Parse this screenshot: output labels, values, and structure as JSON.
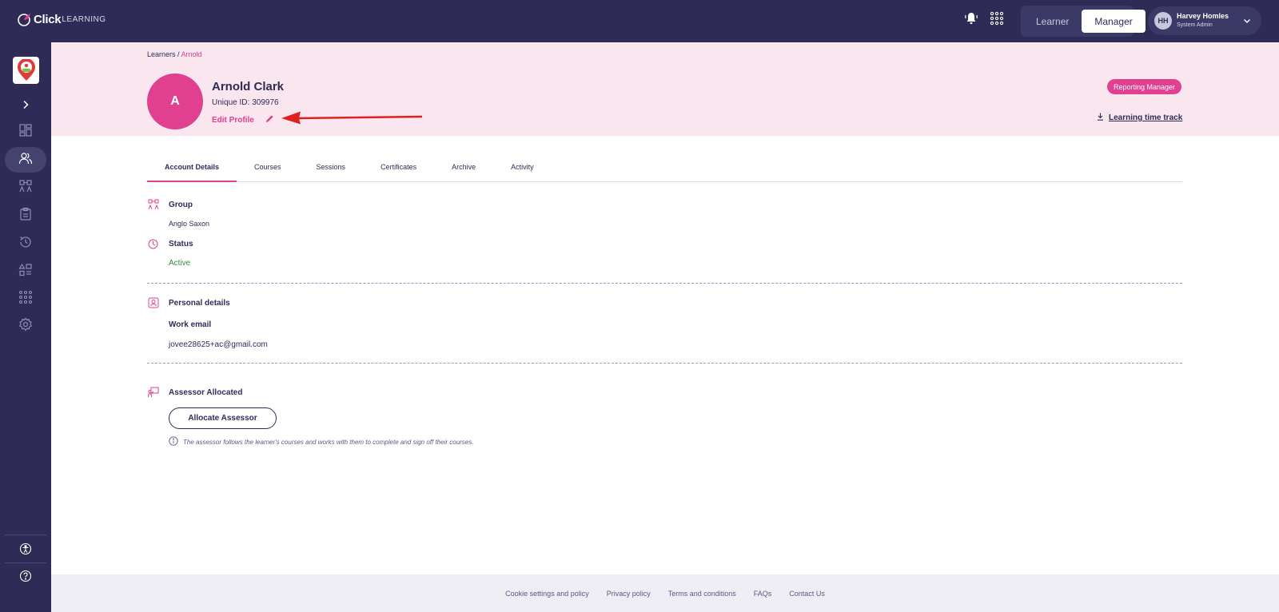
{
  "brand": {
    "click": "Click",
    "learning": "LEARNING"
  },
  "topbar": {
    "roles": [
      {
        "label": "Learner",
        "active": false
      },
      {
        "label": "Manager",
        "active": true
      }
    ],
    "user": {
      "initials": "HH",
      "name": "Harvey Homles",
      "role": "System Admin"
    }
  },
  "sidebar": {
    "items": [
      {
        "name": "expand-chevron-icon"
      },
      {
        "name": "dashboard-icon"
      },
      {
        "name": "learners-icon",
        "active": true
      },
      {
        "name": "groups-icon"
      },
      {
        "name": "clipboard-icon"
      },
      {
        "name": "history-icon"
      },
      {
        "name": "reports-icon"
      },
      {
        "name": "apps-grid-icon"
      },
      {
        "name": "settings-icon"
      }
    ],
    "bottom": [
      {
        "name": "accessibility-icon"
      },
      {
        "name": "help-icon"
      }
    ]
  },
  "breadcrumb": {
    "parent": "Learners",
    "separator": " / ",
    "current": "Arnold"
  },
  "profile": {
    "initial": "A",
    "name": "Arnold Clark",
    "unique_id_label": "Unique ID:",
    "unique_id": "309976",
    "edit_label": "Edit Profile",
    "badge": "Reporting Manager",
    "time_track": "Learning time track"
  },
  "tabs": [
    "Account Details",
    "Courses",
    "Sessions",
    "Certificates",
    "Archive",
    "Activity"
  ],
  "active_tab": "Account Details",
  "account": {
    "group_label": "Group",
    "group_value": "Anglo Saxon",
    "status_label": "Status",
    "status_value": "Active",
    "personal_label": "Personal details",
    "email_label": "Work email",
    "email_value": "jovee28625+ac@gmail.com",
    "assessor_label": "Assessor Allocated",
    "assessor_button": "Allocate Assessor",
    "assessor_hint": "The assessor follows the learner's courses and works with them to complete and sign off their courses."
  },
  "footer": [
    "Cookie settings and policy",
    "Privacy policy",
    "Terms and conditions",
    "FAQs",
    "Contact Us"
  ],
  "colors": {
    "navy": "#2e2c57",
    "pink": "#e0408f",
    "header_bg": "#f9e6ee",
    "active_green": "#3a8a3a"
  }
}
